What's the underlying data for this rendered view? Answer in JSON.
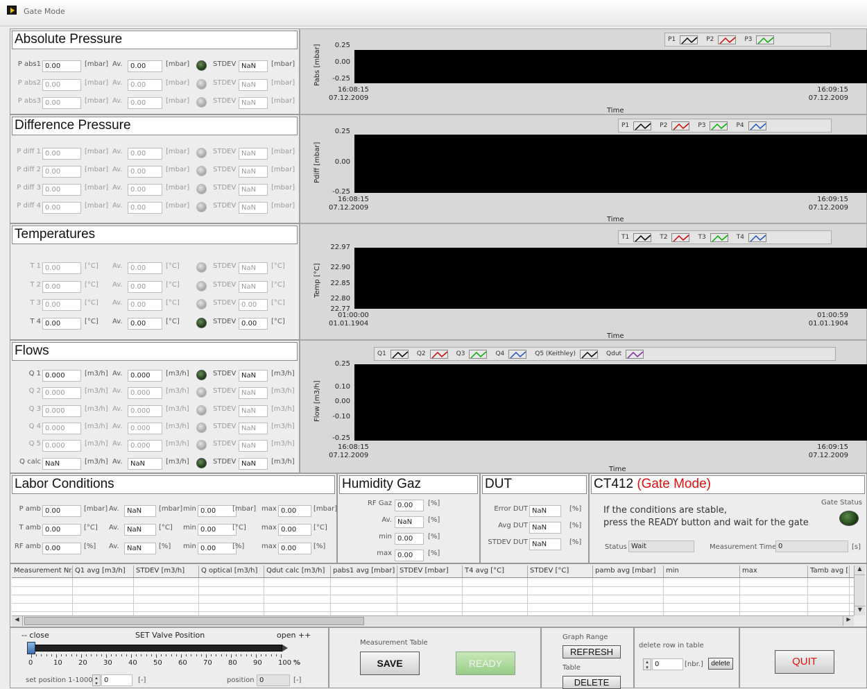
{
  "window": {
    "title": "Gate Mode"
  },
  "abs": {
    "title": "Absolute Pressure",
    "rows": [
      {
        "label": "P abs1",
        "val": "0.00",
        "unit": "[mbar]",
        "av_label": "Av.",
        "av": "0.00",
        "stdev_label": "STDEV",
        "stdev": "NaN",
        "active": true
      },
      {
        "label": "P abs2",
        "val": "0.00",
        "unit": "[mbar]",
        "av_label": "Av.",
        "av": "0.00",
        "stdev_label": "STDEV",
        "stdev": "NaN",
        "active": false
      },
      {
        "label": "P abs3",
        "val": "0.00",
        "unit": "[mbar]",
        "av_label": "Av.",
        "av": "0.00",
        "stdev_label": "STDEV",
        "stdev": "NaN",
        "active": false
      }
    ]
  },
  "diff": {
    "title": "Difference Pressure",
    "rows": [
      {
        "label": "P diff 1",
        "val": "0.00",
        "unit": "[mbar]",
        "av_label": "Av.",
        "av": "0.00",
        "stdev_label": "STDEV",
        "stdev": "NaN",
        "active": false
      },
      {
        "label": "P diff 2",
        "val": "0.00",
        "unit": "[mbar]",
        "av_label": "Av.",
        "av": "0.00",
        "stdev_label": "STDEV",
        "stdev": "NaN",
        "active": false
      },
      {
        "label": "P diff 3",
        "val": "0.00",
        "unit": "[mbar]",
        "av_label": "Av.",
        "av": "0.00",
        "stdev_label": "STDEV",
        "stdev": "NaN",
        "active": false
      },
      {
        "label": "P diff 4",
        "val": "0.00",
        "unit": "[mbar]",
        "av_label": "Av.",
        "av": "0.00",
        "stdev_label": "STDEV",
        "stdev": "NaN",
        "active": false
      }
    ]
  },
  "temp": {
    "title": "Temperatures",
    "rows": [
      {
        "label": "T 1",
        "val": "0.00",
        "unit": "[°C]",
        "av_label": "Av.",
        "av": "0.00",
        "stdev_label": "STDEV",
        "stdev": "NaN",
        "active": false
      },
      {
        "label": "T 2",
        "val": "0.00",
        "unit": "[°C]",
        "av_label": "Av.",
        "av": "0.00",
        "stdev_label": "STDEV",
        "stdev": "NaN",
        "active": false
      },
      {
        "label": "T 3",
        "val": "0.00",
        "unit": "[°C]",
        "av_label": "Av.",
        "av": "0.00",
        "stdev_label": "STDEV",
        "stdev": "0.00",
        "active": false
      },
      {
        "label": "T 4",
        "val": "0.00",
        "unit": "[°C]",
        "av_label": "Av.",
        "av": "0.00",
        "stdev_label": "STDEV",
        "stdev": "0.00",
        "active": true
      }
    ]
  },
  "flows": {
    "title": "Flows",
    "rows": [
      {
        "label": "Q 1",
        "val": "0.000",
        "unit": "[m3/h]",
        "av_label": "Av.",
        "av": "0.000",
        "stdev_label": "STDEV",
        "stdev": "NaN",
        "active": true
      },
      {
        "label": "Q 2",
        "val": "0.000",
        "unit": "[m3/h]",
        "av_label": "Av.",
        "av": "0.000",
        "stdev_label": "STDEV",
        "stdev": "NaN",
        "active": false
      },
      {
        "label": "Q 3",
        "val": "0.000",
        "unit": "[m3/h]",
        "av_label": "Av.",
        "av": "0.000",
        "stdev_label": "STDEV",
        "stdev": "NaN",
        "active": false
      },
      {
        "label": "Q 4",
        "val": "0.000",
        "unit": "[m3/h]",
        "av_label": "Av.",
        "av": "0.000",
        "stdev_label": "STDEV",
        "stdev": "NaN",
        "active": false
      },
      {
        "label": "Q 5",
        "val": "0.000",
        "unit": "[m3/h]",
        "av_label": "Av.",
        "av": "0.000",
        "stdev_label": "STDEV",
        "stdev": "NaN",
        "active": false
      },
      {
        "label": "Q calc",
        "val": "NaN",
        "unit": "[m3/h]",
        "av_label": "Av.",
        "av": "NaN",
        "stdev_label": "STDEV",
        "stdev": "NaN",
        "active": true
      }
    ]
  },
  "charts": [
    {
      "ylabel": "Pabs [mbar]",
      "yticks": [
        "0.25",
        "0.00",
        "-0.25"
      ],
      "xstart": [
        "16:08:15",
        "07.12.2009"
      ],
      "xend": [
        "16:09:15",
        "07.12.2009"
      ],
      "xlabel": "Time",
      "legend": [
        {
          "name": "P1",
          "color": "#000000"
        },
        {
          "name": "P2",
          "color": "#cc0000"
        },
        {
          "name": "P3",
          "color": "#00aa00"
        }
      ]
    },
    {
      "ylabel": "Pdiff [mbar]",
      "yticks": [
        "0.25",
        "0.00",
        "-0.25"
      ],
      "xstart": [
        "16:08:15",
        "07.12.2009"
      ],
      "xend": [
        "16:09:15",
        "07.12.2009"
      ],
      "xlabel": "Time",
      "legend": [
        {
          "name": "P1",
          "color": "#000000"
        },
        {
          "name": "P2",
          "color": "#cc0000"
        },
        {
          "name": "P3",
          "color": "#00aa00"
        },
        {
          "name": "P4",
          "color": "#2050c0"
        }
      ]
    },
    {
      "ylabel": "Temp [°C]",
      "yticks": [
        "22.97",
        "22.90",
        "22.85",
        "22.80",
        "22.77"
      ],
      "xstart": [
        "01:00:00",
        "01.01.1904"
      ],
      "xend": [
        "01:00:59",
        "01.01.1904"
      ],
      "xlabel": "Time",
      "legend": [
        {
          "name": "T1",
          "color": "#000000"
        },
        {
          "name": "T2",
          "color": "#cc0000"
        },
        {
          "name": "T3",
          "color": "#00aa00"
        },
        {
          "name": "T4",
          "color": "#2050c0"
        }
      ]
    },
    {
      "ylabel": "Flow [m3/h]",
      "yticks": [
        "0.25",
        "0.10",
        "0.00",
        "-0.10",
        "-0.25"
      ],
      "xstart": [
        "16:08:15",
        "07.12.2009"
      ],
      "xend": [
        "16:09:15",
        "07.12.2009"
      ],
      "xlabel": "Time",
      "legend": [
        {
          "name": "Q1",
          "color": "#000000"
        },
        {
          "name": "Q2",
          "color": "#cc0000"
        },
        {
          "name": "Q3",
          "color": "#00aa00"
        },
        {
          "name": "Q4",
          "color": "#2050c0"
        },
        {
          "name": "Q5 (Keithley)",
          "color": "#000000"
        },
        {
          "name": "Qdut",
          "color": "#8020a0"
        }
      ]
    }
  ],
  "labor": {
    "title": "Labor Conditions",
    "rows": [
      {
        "label": "P amb",
        "val": "0.00",
        "unit": "[mbar]",
        "av_label": "Av.",
        "av": "NaN",
        "av_unit": "[mbar]",
        "min_label": "min",
        "min": "0.00",
        "min_unit": "[mbar]",
        "max_label": "max",
        "max": "0.00",
        "max_unit": "[mbar]"
      },
      {
        "label": "T amb",
        "val": "0.00",
        "unit": "[°C]",
        "av_label": "Av.",
        "av": "NaN",
        "av_unit": "[°C]",
        "min_label": "min",
        "min": "0.00",
        "min_unit": "[°C]",
        "max_label": "max",
        "max": "0.00",
        "max_unit": "[°C]"
      },
      {
        "label": "RF amb",
        "val": "0.00",
        "unit": "[%]",
        "av_label": "Av.",
        "av": "NaN",
        "av_unit": "[%]",
        "min_label": "min",
        "min": "0.00",
        "min_unit": "[%]",
        "max_label": "max",
        "max": "0.00",
        "max_unit": "[%]"
      }
    ]
  },
  "humidity": {
    "title": "Humidity Gaz",
    "rows": [
      {
        "label": "RF Gaz",
        "val": "0.00",
        "unit": "[%]"
      },
      {
        "label": "Av.",
        "val": "NaN",
        "unit": "[%]"
      },
      {
        "label": "min",
        "val": "0.00",
        "unit": "[%]"
      },
      {
        "label": "max",
        "val": "0.00",
        "unit": "[%]"
      }
    ]
  },
  "dut": {
    "title": "DUT",
    "rows": [
      {
        "label": "Error DUT",
        "val": "NaN",
        "unit": "[%]"
      },
      {
        "label": "Avg DUT",
        "val": "NaN",
        "unit": "[%]"
      },
      {
        "label": "STDEV DUT",
        "val": "NaN",
        "unit": "[%]"
      }
    ]
  },
  "ct": {
    "title": "CT412",
    "mode": "(Gate Mode)",
    "msg1": "If the conditions are stable,",
    "msg2": "press the READY button and wait for the gate",
    "gate_status_label": "Gate Status",
    "status_label": "Status",
    "status": "Wait",
    "meas_time_label": "Measurement Time",
    "meas_time": "0",
    "meas_time_unit": "[s]"
  },
  "table": {
    "columns": [
      "Measurement Nr.",
      "Q1 avg [m3/h]",
      "STDEV [m3/h]",
      "Q optical [m3/h]",
      "Qdut calc [m3/h]",
      "pabs1 avg [mbar]",
      "STDEV [mbar]",
      "T4 avg [°C]",
      "STDEV [°C]",
      "pamb avg [mbar]",
      "min",
      "max",
      "Tamb avg [°C]"
    ]
  },
  "valve": {
    "close_label": "-- close",
    "set_label": "SET  Valve Position",
    "open_label": "open ++",
    "position_percent": 0,
    "ticks": [
      "0",
      "10",
      "20",
      "30",
      "40",
      "50",
      "60",
      "70",
      "80",
      "90",
      "100"
    ],
    "pct": "%",
    "setpos_label": "set position 1-1000",
    "setpos": "0",
    "setpos_unit": "[-]",
    "pos_label": "position",
    "pos": "0",
    "pos_unit": "[-]"
  },
  "meas": {
    "label": "Measurement Table",
    "save": "SAVE",
    "ready": "READY"
  },
  "graph": {
    "label": "Graph Range",
    "refresh": "REFRESH",
    "table_label": "Table",
    "delete": "DELETE"
  },
  "delrow": {
    "label": "delete row in table",
    "val": "0",
    "unit": "[nbr.]",
    "btn": "delete"
  },
  "quit": {
    "label": "QUIT"
  }
}
